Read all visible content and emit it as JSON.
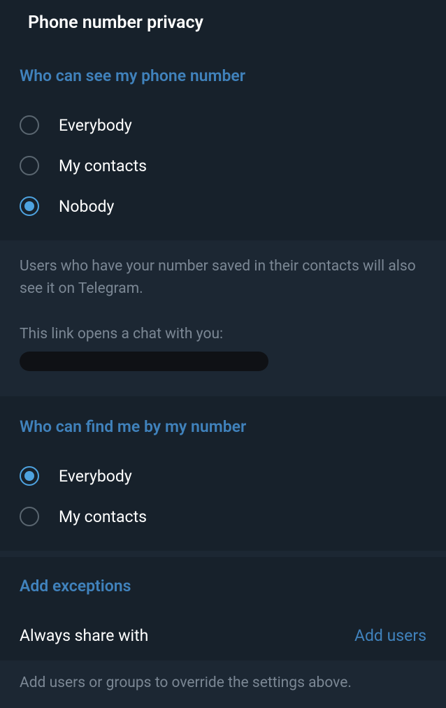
{
  "page": {
    "title": "Phone number privacy"
  },
  "section_see": {
    "header": "Who can see my phone number",
    "options": [
      "Everybody",
      "My contacts",
      "Nobody"
    ],
    "selected": "Nobody",
    "description1": "Users who have your number saved in their contacts will also see it on Telegram.",
    "description2": "This link opens a chat with you:"
  },
  "section_find": {
    "header": "Who can find me by my number",
    "options": [
      "Everybody",
      "My contacts"
    ],
    "selected": "Everybody"
  },
  "section_exceptions": {
    "header": "Add exceptions",
    "row_label": "Always share with",
    "row_action": "Add users",
    "footer": "Add users or groups to override the settings above."
  }
}
